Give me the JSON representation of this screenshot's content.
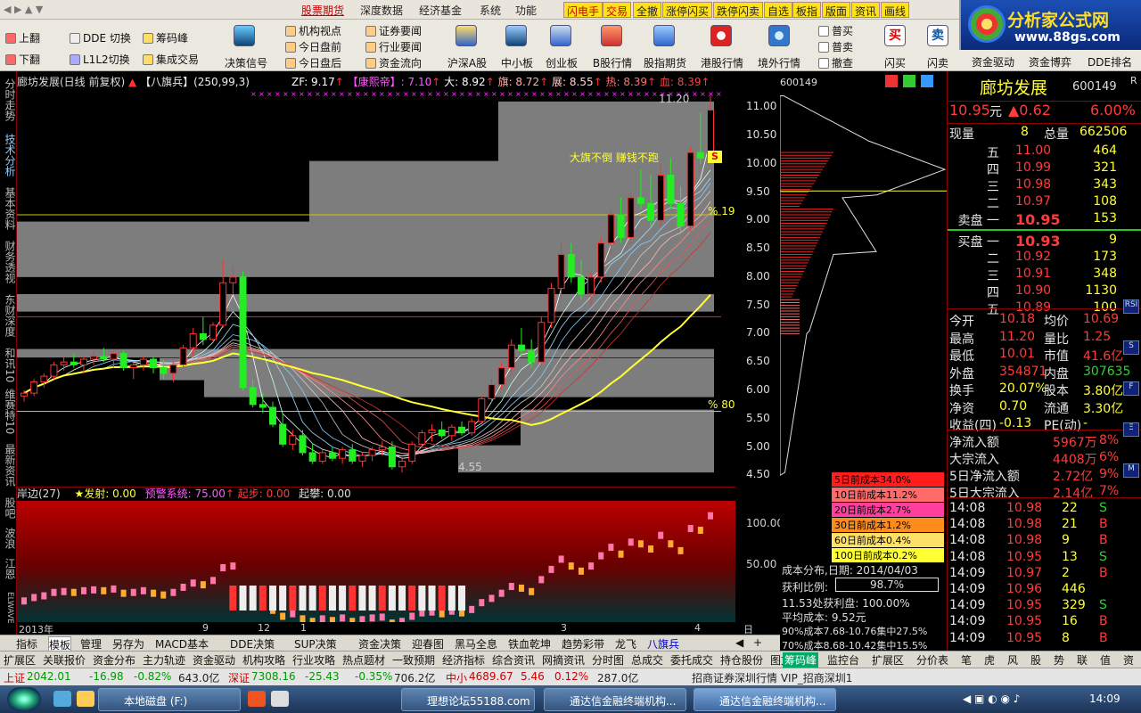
{
  "menubar": {
    "items": [
      "股票期货",
      "深度数据",
      "经济基金",
      "系统",
      "功能"
    ],
    "quick": [
      "闪电手",
      "交易",
      "全撤",
      "涨停闪买",
      "跌停闪卖",
      "自选",
      "板指",
      "版面",
      "资讯",
      "画线"
    ]
  },
  "logo": {
    "title": "分析家公式网",
    "url": "www.88gs.com"
  },
  "toolbar": {
    "left": [
      {
        "a": "上翻",
        "b": "下翻"
      },
      {
        "a": "DDE 切换",
        "b": "L1L2切换"
      },
      {
        "a": "筹码峰",
        "b": "集成交易"
      }
    ],
    "decision": "决策信号",
    "col1": [
      "机构视点",
      "今日盘前",
      "今日盘后"
    ],
    "col2": [
      "证券要闻",
      "行业要闻",
      "资金流向"
    ],
    "big": [
      "沪深A股",
      "中小板",
      "创业板",
      "B股行情",
      "股指期货",
      "港股行情",
      "境外行情"
    ],
    "trade": [
      "普买",
      "普卖",
      "撤查"
    ],
    "flash": [
      "闪买",
      "闪卖"
    ],
    "row2": [
      "资金驱动",
      "资金博弈",
      "DDE排名"
    ]
  },
  "lefttabs": [
    "分时走势",
    "技术分析",
    "基本资料",
    "财务透视",
    "东财深度",
    "和讯10",
    "维赛特10",
    "最新资讯",
    "股吧",
    "波浪",
    "江恩",
    "ELWAVE"
  ],
  "chart": {
    "title": "廊坊发展(日线 前复权)",
    "indicator": "【八旗兵】(250,99,3)",
    "zf": "ZF: 9.17",
    "kangxi": "【康熙帝】: 7.10",
    "da": "大: 8.92",
    "qi": "旗: 8.72",
    "zhan": "展: 8.55",
    "re": "热: 8.39",
    "xue": "血: 8.39",
    "annot": "大旗不倒 赚钱不跑",
    "hi_label": "11.20",
    "lo_label": "4.55",
    "pct_a": "% 19",
    "pct_b": "% 80",
    "s_badge": "S",
    "yticks": [
      "11.00",
      "10.50",
      "10.00",
      "9.50",
      "9.00",
      "8.50",
      "8.00",
      "7.50",
      "7.00",
      "6.50",
      "6.00",
      "5.50",
      "5.00",
      "4.50"
    ],
    "sub_title": "岸边(27)",
    "sub_vals": [
      "★发射: 0.00",
      "预警系统: 75.00",
      "起步: 0.00",
      "起攀: 0.00"
    ],
    "sub_yticks": [
      "100.00",
      "50.00"
    ],
    "xlabels": [
      "2013年",
      "9",
      "12",
      "1",
      "3",
      "4"
    ],
    "period": "日线"
  },
  "chart_data": {
    "type": "candlestick",
    "y_range": [
      4.3,
      11.35
    ],
    "candles": [
      [
        5.9,
        6.0,
        5.8,
        5.95
      ],
      [
        5.95,
        6.2,
        5.9,
        6.15
      ],
      [
        6.15,
        6.3,
        6.05,
        6.25
      ],
      [
        6.25,
        6.5,
        6.2,
        6.45
      ],
      [
        6.45,
        6.6,
        6.35,
        6.5
      ],
      [
        6.5,
        6.65,
        6.4,
        6.45
      ],
      [
        6.45,
        6.6,
        6.3,
        6.55
      ],
      [
        6.55,
        6.7,
        6.45,
        6.6
      ],
      [
        6.6,
        6.75,
        6.5,
        6.55
      ],
      [
        6.55,
        6.7,
        6.4,
        6.65
      ],
      [
        6.65,
        6.7,
        6.35,
        6.4
      ],
      [
        6.4,
        6.5,
        6.2,
        6.45
      ],
      [
        6.45,
        6.6,
        6.35,
        6.55
      ],
      [
        6.55,
        6.6,
        6.3,
        6.4
      ],
      [
        6.4,
        6.55,
        6.2,
        6.3
      ],
      [
        6.3,
        6.5,
        6.15,
        6.45
      ],
      [
        6.45,
        6.8,
        6.4,
        6.75
      ],
      [
        6.75,
        7.1,
        6.6,
        7.0
      ],
      [
        7.0,
        7.3,
        6.8,
        6.9
      ],
      [
        6.9,
        7.2,
        6.85,
        7.15
      ],
      [
        7.15,
        8.3,
        7.1,
        7.9
      ],
      [
        7.9,
        8.2,
        7.7,
        8.0
      ],
      [
        8.0,
        8.1,
        6.0,
        6.05
      ],
      [
        6.05,
        6.2,
        5.7,
        5.75
      ],
      [
        5.75,
        5.95,
        5.6,
        5.7
      ],
      [
        5.7,
        5.8,
        5.35,
        5.4
      ],
      [
        5.4,
        5.6,
        5.0,
        5.05
      ],
      [
        5.05,
        5.3,
        4.95,
        5.2
      ],
      [
        5.2,
        5.3,
        4.85,
        4.9
      ],
      [
        4.9,
        5.05,
        4.7,
        4.75
      ],
      [
        4.75,
        4.95,
        4.7,
        4.9
      ],
      [
        4.9,
        5.0,
        4.75,
        4.8
      ],
      [
        4.8,
        5.0,
        4.7,
        4.95
      ],
      [
        4.95,
        5.05,
        4.7,
        4.75
      ],
      [
        4.75,
        4.9,
        4.65,
        4.85
      ],
      [
        4.85,
        5.0,
        4.75,
        4.95
      ],
      [
        4.95,
        5.1,
        4.85,
        5.0
      ],
      [
        5.0,
        5.1,
        4.6,
        4.65
      ],
      [
        4.65,
        4.8,
        4.55,
        4.75
      ],
      [
        4.75,
        5.1,
        4.7,
        5.05
      ],
      [
        5.05,
        5.3,
        5.0,
        5.25
      ],
      [
        5.25,
        5.4,
        5.1,
        5.3
      ],
      [
        5.3,
        5.45,
        5.15,
        5.2
      ],
      [
        5.2,
        5.4,
        5.1,
        5.35
      ],
      [
        5.35,
        5.45,
        5.2,
        5.25
      ],
      [
        5.25,
        5.5,
        5.2,
        5.45
      ],
      [
        5.45,
        5.9,
        5.4,
        5.85
      ],
      [
        5.85,
        6.2,
        5.8,
        6.1
      ],
      [
        6.1,
        6.5,
        6.0,
        6.4
      ],
      [
        6.4,
        6.9,
        6.3,
        6.8
      ],
      [
        6.8,
        7.1,
        6.6,
        6.7
      ],
      [
        6.7,
        6.9,
        6.4,
        6.5
      ],
      [
        6.5,
        7.3,
        6.45,
        7.2
      ],
      [
        7.2,
        7.9,
        7.1,
        7.8
      ],
      [
        7.8,
        8.6,
        7.6,
        8.4
      ],
      [
        8.4,
        8.6,
        7.9,
        8.0
      ],
      [
        8.0,
        8.3,
        7.6,
        7.7
      ],
      [
        7.7,
        8.1,
        7.5,
        8.0
      ],
      [
        8.0,
        8.7,
        7.9,
        8.6
      ],
      [
        8.6,
        9.2,
        8.4,
        9.1
      ],
      [
        9.1,
        9.4,
        8.6,
        8.7
      ],
      [
        8.7,
        9.5,
        8.6,
        9.4
      ],
      [
        9.4,
        9.9,
        9.2,
        9.3
      ],
      [
        9.3,
        9.8,
        8.9,
        9.0
      ],
      [
        9.0,
        10.0,
        8.9,
        9.8
      ],
      [
        9.8,
        10.1,
        9.2,
        9.3
      ],
      [
        9.3,
        9.6,
        8.8,
        8.9
      ],
      [
        8.9,
        10.3,
        8.8,
        10.2
      ],
      [
        10.2,
        10.9,
        10.0,
        10.1
      ],
      [
        10.1,
        11.2,
        10.0,
        10.95
      ]
    ],
    "chip_ranges": [
      [
        9.73,
        11.1
      ],
      [
        8.78,
        10.05
      ],
      [
        8.0,
        8.98
      ],
      [
        7.39,
        7.7
      ],
      [
        6.73,
        6.58
      ],
      [
        6.18,
        6.57
      ],
      [
        5.88,
        6.2
      ],
      [
        4.61,
        5.66
      ],
      [
        4.55,
        5.03
      ]
    ],
    "note": "OHLC values estimated from the price axis; chip ranges are the grey bands (low, high)."
  },
  "chips": {
    "code": "600149",
    "legend": [
      {
        "label": "5日前成本34.0%",
        "color": "#ff1d1d"
      },
      {
        "label": "10日前成本11.2%",
        "color": "#ff6b6b"
      },
      {
        "label": "20日前成本2.7%",
        "color": "#ff3f9e"
      },
      {
        "label": "30日前成本1.2%",
        "color": "#ff8c1a"
      },
      {
        "label": "60日前成本0.4%",
        "color": "#ffe066"
      },
      {
        "label": "100日前成本0.2%",
        "color": "#ffff33"
      }
    ],
    "date": "成本分布,日期: 2014/04/03",
    "ratio_label": "获利比例:",
    "ratio": "98.7%",
    "lines": [
      "11.53处获利盘: 100.00%",
      "平均成本: 9.52元",
      "90%成本7.68-10.76集中27.5%",
      "70%成本8.68-10.42集中15.5%"
    ]
  },
  "quote": {
    "name": "廊坊发展",
    "code": "600149",
    "flag": "R",
    "price": "10.95",
    "unit": "元",
    "change": "▲0.62",
    "pct": "6.00%",
    "now_label": "现量",
    "now": "8",
    "total_label": "总量",
    "total": "662506",
    "sell": [
      {
        "l": "五",
        "p": "11.00",
        "v": "464"
      },
      {
        "l": "四",
        "p": "10.99",
        "v": "321"
      },
      {
        "l": "三",
        "p": "10.98",
        "v": "343"
      },
      {
        "l": "二",
        "p": "10.97",
        "v": "108"
      },
      {
        "l": "卖盘 一",
        "p": "10.95",
        "v": "153"
      }
    ],
    "buy": [
      {
        "l": "买盘 一",
        "p": "10.93",
        "v": "9"
      },
      {
        "l": "二",
        "p": "10.92",
        "v": "173"
      },
      {
        "l": "三",
        "p": "10.91",
        "v": "348"
      },
      {
        "l": "四",
        "p": "10.90",
        "v": "1130"
      },
      {
        "l": "五",
        "p": "10.89",
        "v": "100"
      }
    ],
    "stats": [
      [
        "今开",
        "10.18",
        "均价",
        "10.69"
      ],
      [
        "最高",
        "11.20",
        "量比",
        "1.25"
      ],
      [
        "最低",
        "10.01",
        "市值",
        "41.6亿"
      ],
      [
        "外盘",
        "354871",
        "内盘",
        "307635"
      ],
      [
        "换手",
        "20.07%",
        "股本",
        "3.80亿"
      ],
      [
        "净资",
        "0.70",
        "流通",
        "3.30亿"
      ],
      [
        "收益(四)",
        "-0.13",
        "PE(动)",
        "-"
      ]
    ],
    "flows": [
      [
        "净流入额",
        "5967万",
        "8%"
      ],
      [
        "大宗流入",
        "4408万",
        "6%"
      ],
      [
        "5日净流入额",
        "2.72亿",
        "9%"
      ],
      [
        "5日大宗流入",
        "2.14亿",
        "7%"
      ]
    ],
    "ticks": [
      [
        "14:08",
        "10.98",
        "22",
        "S"
      ],
      [
        "14:08",
        "10.98",
        "21",
        "B"
      ],
      [
        "14:08",
        "10.98",
        "9",
        "B"
      ],
      [
        "14:08",
        "10.95",
        "13",
        "S"
      ],
      [
        "14:09",
        "10.97",
        "2",
        "B"
      ],
      [
        "14:09",
        "10.96",
        "446",
        ""
      ],
      [
        "14:09",
        "10.95",
        "329",
        "S"
      ],
      [
        "14:09",
        "10.95",
        "16",
        "B"
      ],
      [
        "14:09",
        "10.95",
        "8",
        "B"
      ]
    ],
    "sideicons": [
      "RSI",
      "S",
      "F",
      "Ξ",
      "M"
    ]
  },
  "bottomtabs": [
    "指标",
    "模板",
    "管理",
    "另存为",
    "MACD基本",
    "DDE决策",
    "SUP决策",
    "资金决策",
    "迎春图",
    "黑马全息",
    "铁血乾坤",
    "趋势彩带",
    "龙飞",
    "八旗兵"
  ],
  "bottomtabs2": [
    "扩展区",
    "关联报价",
    "资金分布",
    "主力轨迹",
    "资金驱动",
    "机构攻略",
    "行业攻略",
    "热点题材",
    "一致预期",
    "经济指标",
    "综合资讯",
    "网摘资讯",
    "分时图",
    "总成交",
    "委托成交",
    "持仓股份",
    "图文F10"
  ],
  "bottomtabs3": [
    "筹码峰",
    "监控台",
    "扩展区",
    "分价表",
    "笔",
    "虎",
    "风",
    "股",
    "势",
    "联",
    "值",
    "资"
  ],
  "status": {
    "sh_label": "上证",
    "sh": "2042.01",
    "sh_chg": "-16.98",
    "sh_pct": "-0.82%",
    "sh_amt": "643.0亿",
    "sz_label": "深证",
    "sz": "7308.16",
    "sz_chg": "-25.43",
    "sz_pct": "-0.35%",
    "sz_amt": "706.2亿",
    "zx_label": "中小",
    "zx": "4689.67",
    "zx_chg": "5.46",
    "zx_pct": "0.12%",
    "zx_amt": "287.0亿",
    "broker": "招商证券深圳行情 VIP_招商深圳1"
  },
  "taskbar": {
    "items": [
      "本地磁盘 (F:)",
      "理想论坛55188.com",
      "通达信金融终端机构...",
      "通达信金融终端机构..."
    ],
    "clock": "14:09"
  }
}
